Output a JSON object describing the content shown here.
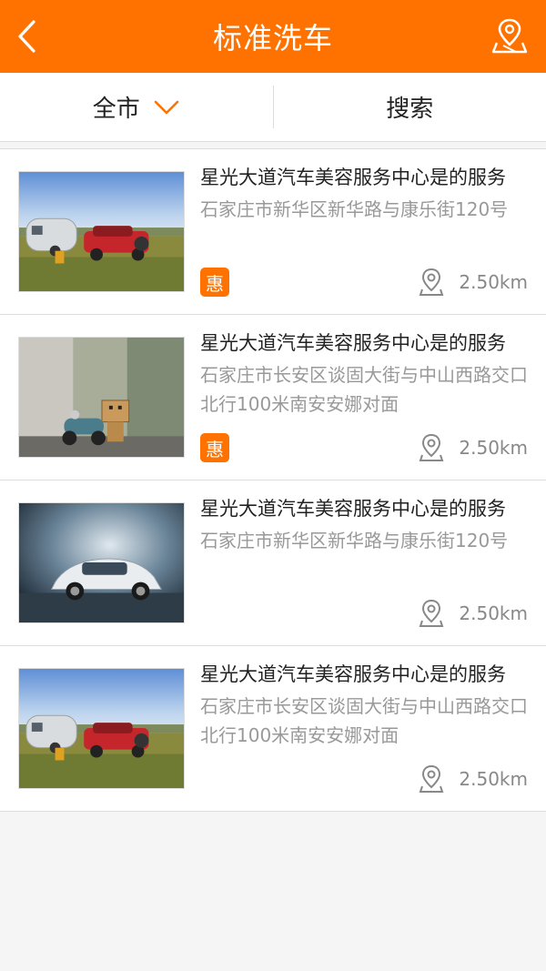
{
  "header": {
    "title": "标准洗车",
    "back_icon": "chevron-left-icon",
    "location_icon": "map-pin-icon"
  },
  "filter": {
    "city_label": "全市",
    "search_label": "搜索"
  },
  "colors": {
    "brand": "#ff7200",
    "text": "#222222",
    "muted": "#999999"
  },
  "items": [
    {
      "name": "星光大道汽车美容服务中心是的服务",
      "address": "石家庄市新华区新华路与康乐街120号",
      "badge": "惠",
      "distance": "2.50km",
      "image": "camper-car-field"
    },
    {
      "name": "星光大道汽车美容服务中心是的服务",
      "address": "石家庄市长安区谈固大街与中山西路交口北行100米南安安娜对面",
      "badge": "惠",
      "distance": "2.50km",
      "image": "toy-robot-scooter"
    },
    {
      "name": "星光大道汽车美容服务中心是的服务",
      "address": "石家庄市新华区新华路与康乐街120号",
      "badge": "",
      "distance": "2.50km",
      "image": "white-car-studio"
    },
    {
      "name": "星光大道汽车美容服务中心是的服务",
      "address": "石家庄市长安区谈固大街与中山西路交口北行100米南安安娜对面",
      "badge": "",
      "distance": "2.50km",
      "image": "camper-car-field"
    }
  ]
}
